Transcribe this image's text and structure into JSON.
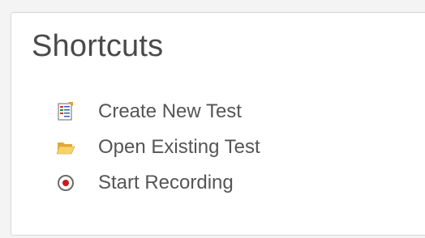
{
  "panel": {
    "title": "Shortcuts"
  },
  "shortcuts": {
    "items": [
      {
        "label": "Create New Test",
        "icon": "new-test-document-icon"
      },
      {
        "label": "Open Existing Test",
        "icon": "folder-open-icon"
      },
      {
        "label": "Start Recording",
        "icon": "record-icon"
      }
    ]
  },
  "colors": {
    "title": "#4a4a4a",
    "label": "#555555",
    "record_dot": "#d01818",
    "folder": "#f2c14e"
  }
}
